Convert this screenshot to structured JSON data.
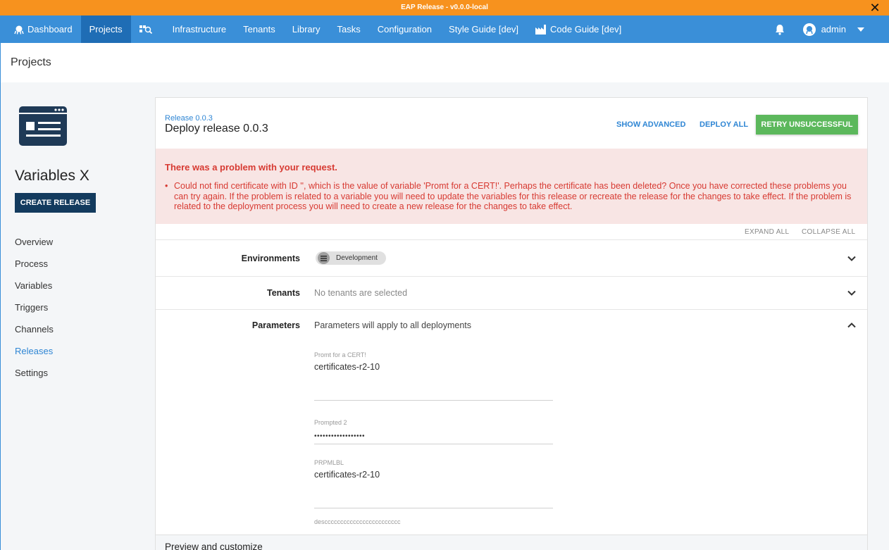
{
  "banner": {
    "text": "EAP Release - v0.0.0-local"
  },
  "nav": {
    "dashboard": "Dashboard",
    "projects": "Projects",
    "infrastructure": "Infrastructure",
    "tenants": "Tenants",
    "library": "Library",
    "tasks": "Tasks",
    "configuration": "Configuration",
    "style_guide": "Style Guide [dev]",
    "code_guide": "Code Guide [dev]",
    "user": "admin"
  },
  "page": {
    "title": "Projects"
  },
  "sidebar": {
    "project_name": "Variables X",
    "create_release": "CREATE RELEASE",
    "items": [
      {
        "label": "Overview",
        "active": false
      },
      {
        "label": "Process",
        "active": false
      },
      {
        "label": "Variables",
        "active": false
      },
      {
        "label": "Triggers",
        "active": false
      },
      {
        "label": "Channels",
        "active": false
      },
      {
        "label": "Releases",
        "active": true
      },
      {
        "label": "Settings",
        "active": false
      }
    ]
  },
  "card": {
    "breadcrumb": "Release 0.0.3",
    "title": "Deploy release 0.0.3",
    "show_advanced": "SHOW ADVANCED",
    "deploy_all": "DEPLOY ALL",
    "retry": "RETRY UNSUCCESSFUL"
  },
  "error": {
    "title": "There was a problem with your request.",
    "message": "Could not find certificate with ID '', which is the value of variable 'Promt for a CERT!'. Perhaps the certificate has been deleted? Once you have corrected these problems you can try again. If the problem is related to a variable you will need to update the variables for this release or recreate the release for the changes to take effect. If the problem is related to the deployment process you will need to create a new release for the changes to take effect."
  },
  "expand": {
    "expand_all": "EXPAND ALL",
    "collapse_all": "COLLAPSE ALL"
  },
  "environments": {
    "label": "Environments",
    "chip": "Development"
  },
  "tenants": {
    "label": "Tenants",
    "value": "No tenants are selected"
  },
  "parameters": {
    "label": "Parameters",
    "value": "Parameters will apply to all deployments",
    "fields": [
      {
        "label": "Promt for a CERT!",
        "value": "certificates-r2-10"
      },
      {
        "label": "Prompted 2",
        "value": "••••••••••••••••••"
      },
      {
        "label": "PRPMLBL",
        "value": "certificates-r2-10",
        "help": "descccccccccccccccccccccccc"
      }
    ]
  },
  "preview": {
    "label": "Preview and customize"
  },
  "colors": {
    "nav": "#3a8fd8",
    "banner": "#f7921e",
    "error_bg": "#f8e5e4",
    "error_text": "#d73a32",
    "retry": "#5cb85c",
    "create": "#133b5e"
  }
}
